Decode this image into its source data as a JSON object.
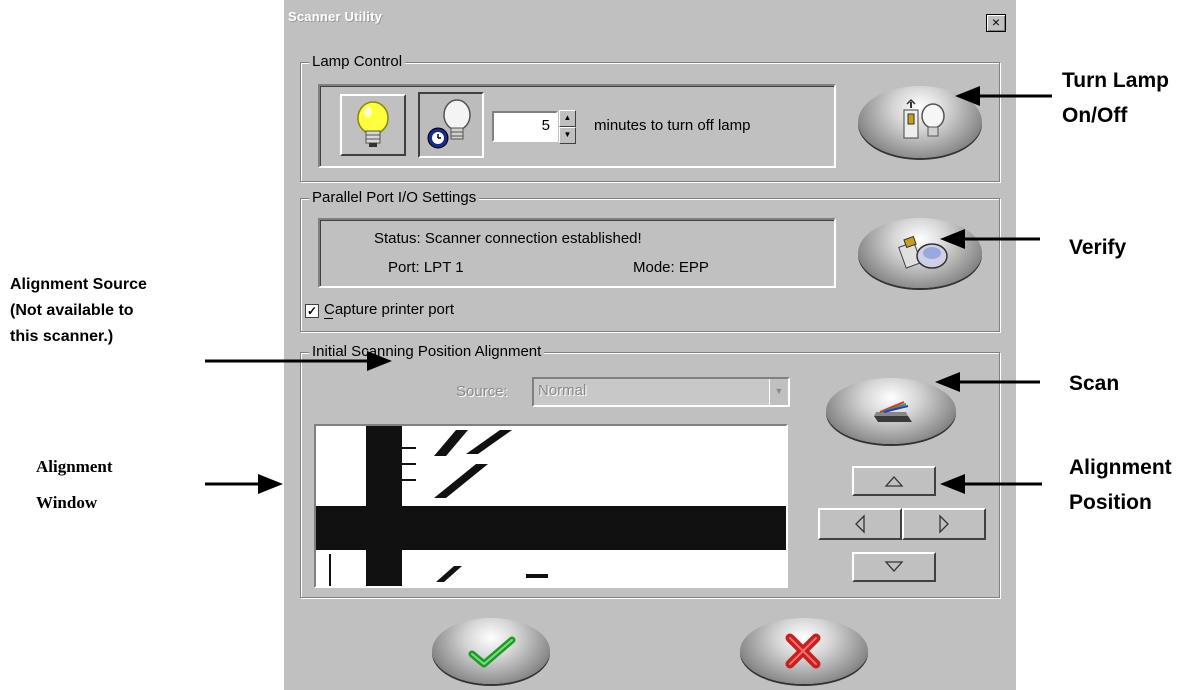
{
  "window": {
    "title": "Scanner Utility",
    "close_label": "×"
  },
  "lamp_control": {
    "group_label": "Lamp Control",
    "minutes_value": "5",
    "minutes_label": "minutes to turn off lamp"
  },
  "parallel_port": {
    "group_label": "Parallel Port I/O Settings",
    "status_text": "Status:  Scanner connection established!",
    "port_text": "Port:  LPT 1",
    "mode_text": "Mode:  EPP",
    "capture_label": "Capture printer port",
    "capture_checked": true
  },
  "alignment": {
    "group_label": "Initial Scanning Position Alignment",
    "source_label": "Source:",
    "source_value": "Normal"
  },
  "annotations": {
    "turn_lamp_line1": "Turn Lamp",
    "turn_lamp_line2": "On/Off",
    "verify": "Verify",
    "alignment_source_line1": "Alignment Source",
    "alignment_source_line2": "(Not available to",
    "alignment_source_line3": "this scanner.)",
    "scan": "Scan",
    "alignment_window_line1": "Alignment",
    "alignment_window_line2": "Window",
    "alignment_position_line1": "Alignment",
    "alignment_position_line2": "Position"
  },
  "colors": {
    "dialog_bg": "#c0c0c0",
    "ok_check": "#1f9a2a",
    "cancel_x": "#c62020"
  },
  "icons": [
    "lamp-on-icon",
    "lamp-timer-icon",
    "lamp-switch-icon",
    "verify-icon",
    "scanner-icon",
    "arrow-up-icon",
    "arrow-left-icon",
    "arrow-right-icon",
    "arrow-down-icon",
    "checkmark-icon",
    "x-icon"
  ]
}
